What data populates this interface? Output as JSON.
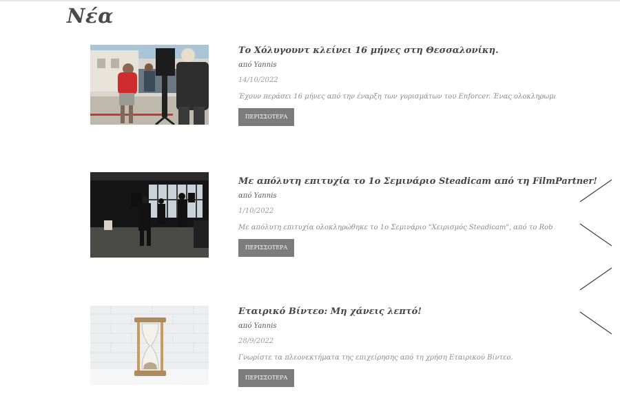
{
  "page": {
    "title": "Νέα"
  },
  "posts": [
    {
      "title": "Το Χόλυγουντ κλείνει 16 μήνες στη Θεσσαλονίκη.",
      "author": "από Yannis",
      "date": "14/10/2022",
      "excerpt": "Έχουν περάσει 16 μήνες από την έναρξη των γυρισμάτων του Enforcer. Ένας ολοκληρωμένος α...",
      "button": "ΠΕΡΙΣΣΟΤΕΡΑ",
      "image": "film-crew-street-photo"
    },
    {
      "title": "Με απόλυτη επιτυχία το 1ο Σεμινάριο Steadicam από τη FilmPartner!",
      "author": "από Yannis",
      "date": "1/10/2022",
      "excerpt": "Με απόλυτη επιτυχία ολοκληρώθηκε το 1ο Σεμινάριο \"Χειρισμός Steadicam\", από το Rob Arro...",
      "button": "ΠΕΡΙΣΣΟΤΕΡΑ",
      "image": "steadicam-seminar-photo"
    },
    {
      "title": "Εταιρικό Βίντεο: Μη χάνεις λεπτό!",
      "author": "από Yannis",
      "date": "28/9/2022",
      "excerpt": "Γνωρίστε τα πλεονεκτήματα της επιχείρησης από τη χρήση Εταιρικού Βίντεο.",
      "button": "ΠΕΡΙΣΣΟΤΕΡΑ",
      "image": "hourglass-photo"
    }
  ],
  "colors": {
    "title": "#4a4a4a",
    "button_bg": "#7c7c7c",
    "button_text": "#ffffff",
    "date": "#9a9a9a"
  },
  "side_decoration": "diagonal-lines-decoration"
}
